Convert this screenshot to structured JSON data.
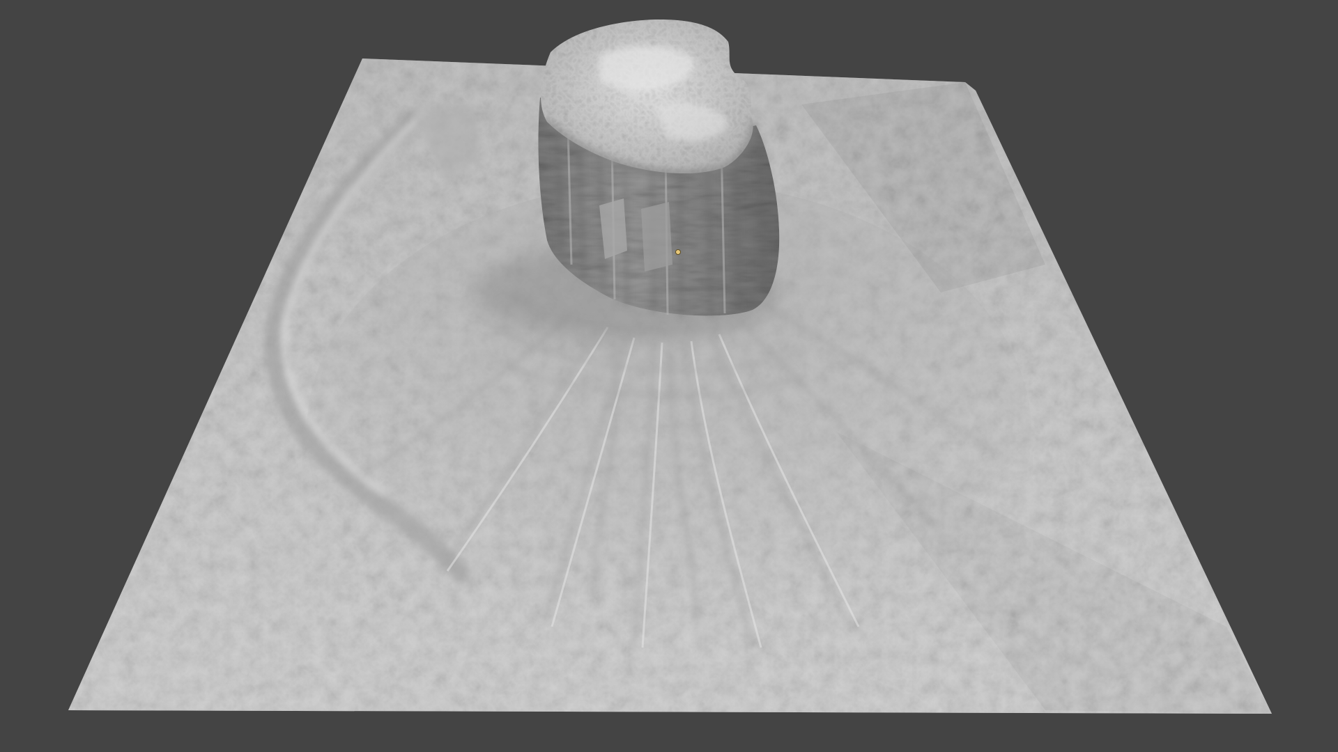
{
  "viewport": {
    "background_color": "#444444",
    "scene": "sculpted-terrain-mesh",
    "shading": "solid-matcap-gray",
    "terrain_color": "#c9c9c9",
    "rock_color": "#8c8c8c",
    "pivot_color": "#e8c87a"
  }
}
